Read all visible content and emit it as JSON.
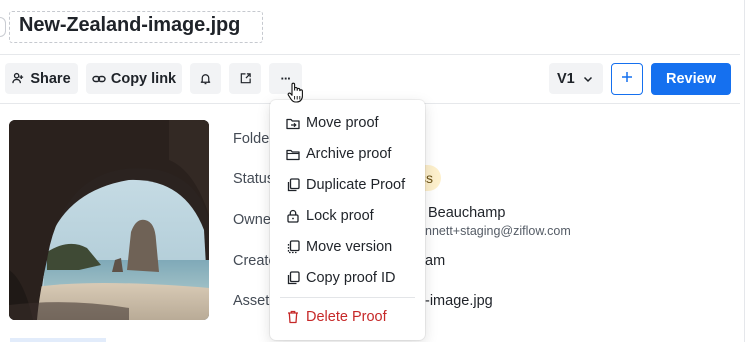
{
  "file": {
    "title": "New-Zealand-image.jpg"
  },
  "toolbar": {
    "share_label": "Share",
    "copy_link_label": "Copy link",
    "more_label": "···",
    "version_label": "V1",
    "review_label": "Review"
  },
  "details": {
    "folder_label": "Folde",
    "status_label": "Status",
    "status_value_partial": "ss",
    "owner_label": "Owne",
    "owner_name_partial": "Beauchamp",
    "owner_email_partial": "nnett+staging@ziflow.com",
    "created_label": "Create",
    "created_value_partial": "am",
    "asset_label": "Asset",
    "asset_value_partial": "-image.jpg"
  },
  "context_menu": {
    "items": [
      {
        "label": "Move proof",
        "icon": "folder-move-icon"
      },
      {
        "label": "Archive proof",
        "icon": "folder-archive-icon"
      },
      {
        "label": "Duplicate Proof",
        "icon": "duplicate-icon"
      },
      {
        "label": "Lock proof",
        "icon": "lock-icon"
      },
      {
        "label": "Move version",
        "icon": "move-version-icon"
      },
      {
        "label": "Copy proof ID",
        "icon": "copy-icon"
      }
    ],
    "danger_item": {
      "label": "Delete Proof",
      "icon": "trash-icon"
    }
  },
  "colors": {
    "primary": "#1570ef",
    "danger": "#c62828",
    "status_pill_bg": "#fdf0cc",
    "button_bg": "#f2f3f5"
  }
}
